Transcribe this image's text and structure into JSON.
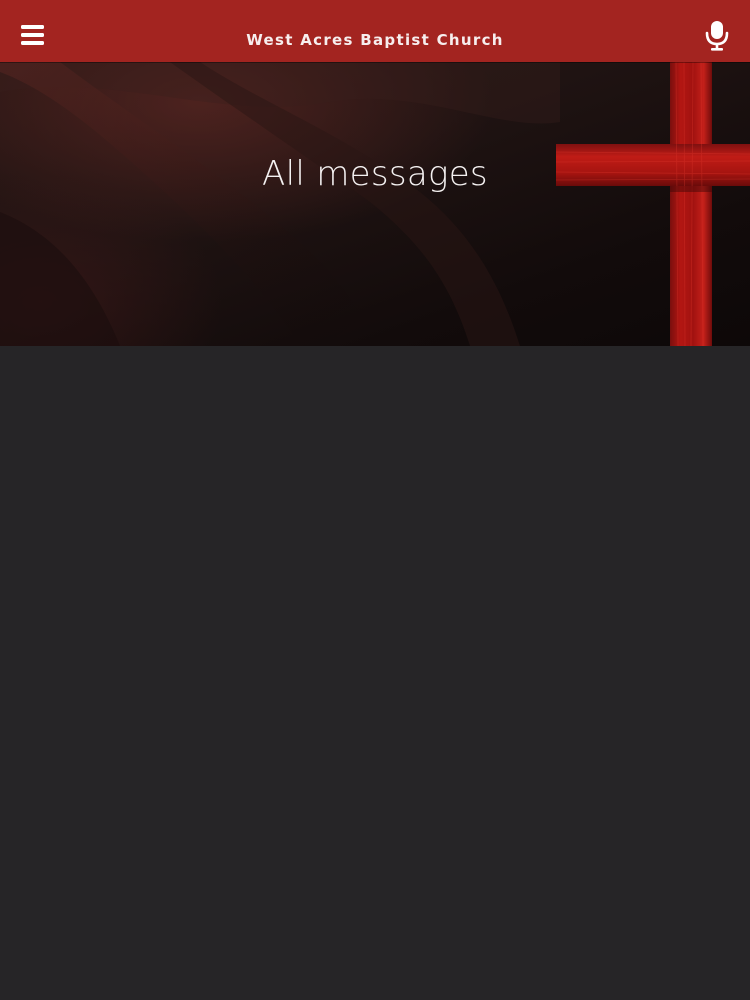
{
  "header": {
    "title": "West Acres Baptist Church",
    "menu_icon": "hamburger-menu-icon",
    "mic_icon": "microphone-icon",
    "background_color": "#a32420"
  },
  "hero": {
    "title": "All messages",
    "image": "red-cross-banner"
  },
  "content": {
    "background_color": "#262527"
  }
}
